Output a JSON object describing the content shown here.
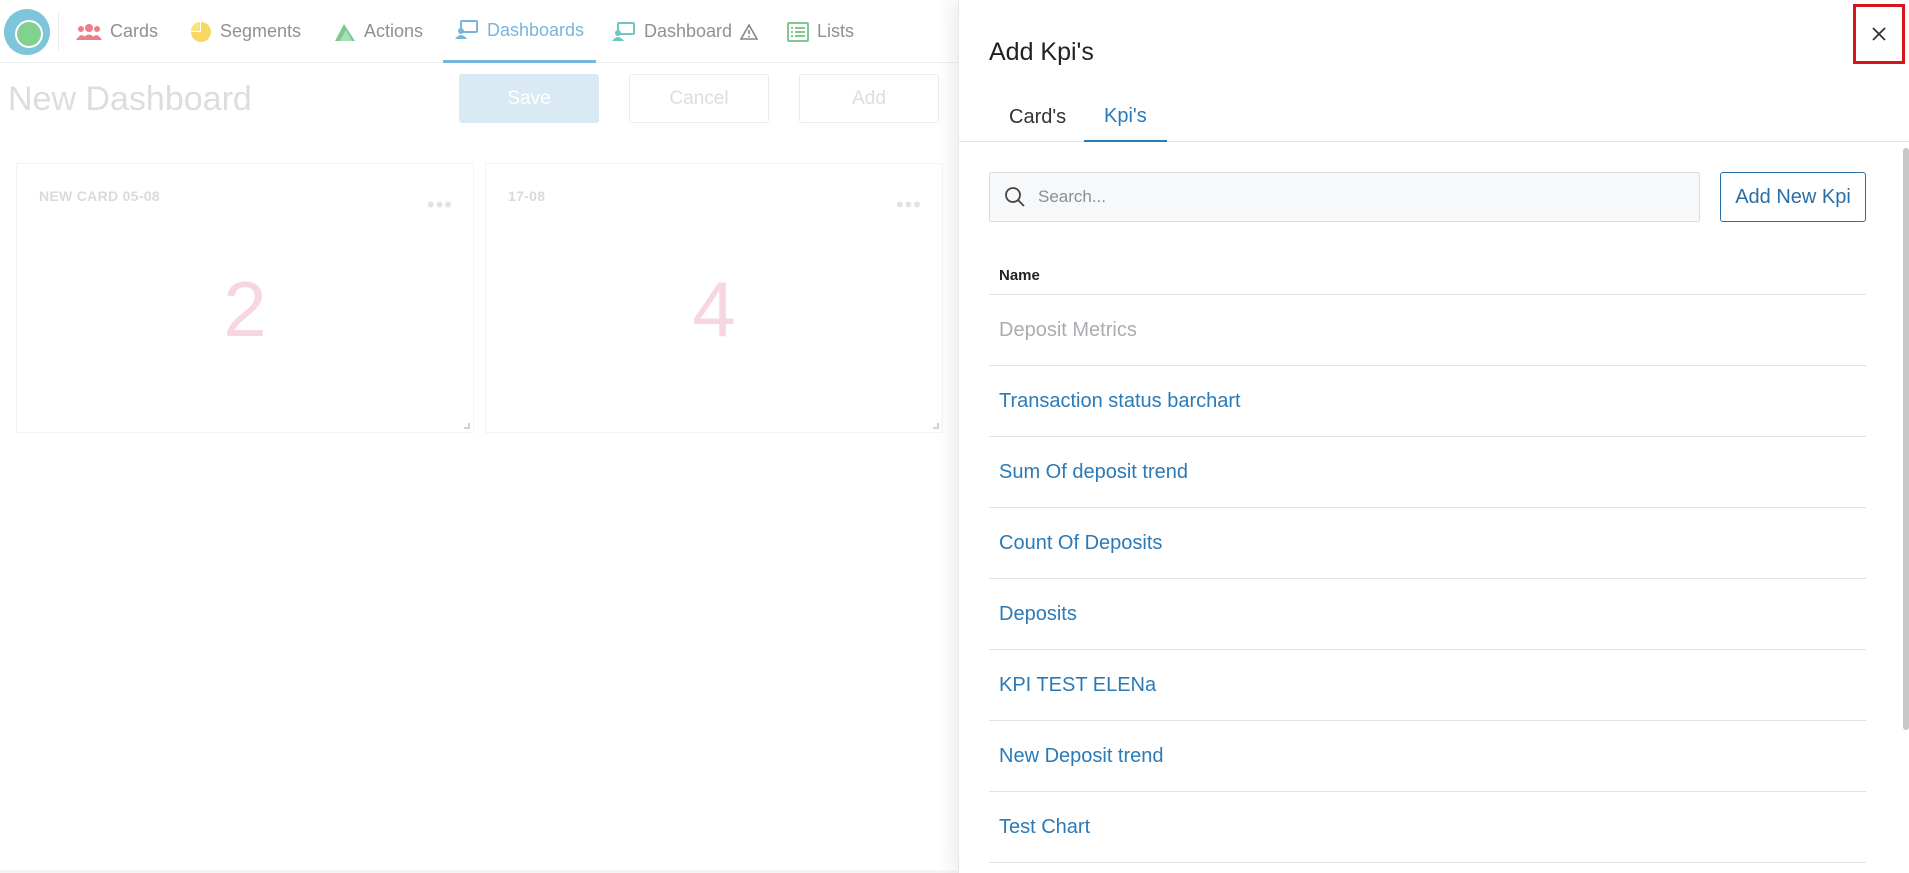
{
  "nav": {
    "items": [
      {
        "label": "Cards",
        "icon": "users-icon",
        "active": false
      },
      {
        "label": "Segments",
        "icon": "pie-chart-icon",
        "active": false
      },
      {
        "label": "Actions",
        "icon": "actions-icon",
        "active": false
      },
      {
        "label": "Dashboards",
        "icon": "dashboard-icon",
        "active": true
      },
      {
        "label": "Dashboard",
        "icon": "dashboard-warning-icon",
        "active": false
      },
      {
        "label": "Lists",
        "icon": "list-icon",
        "active": false
      }
    ]
  },
  "page": {
    "title": "New Dashboard",
    "buttons": {
      "save": "Save",
      "cancel": "Cancel",
      "add": "Add"
    }
  },
  "cards": [
    {
      "title": "NEW CARD 05-08",
      "value": "2"
    },
    {
      "title": "17-08",
      "value": "4"
    }
  ],
  "drawer": {
    "title": "Add Kpi's",
    "tabs": [
      {
        "label": "Card's",
        "active": false
      },
      {
        "label": "Kpi's",
        "active": true
      }
    ],
    "search": {
      "placeholder": "Search..."
    },
    "add_button": "Add New Kpi",
    "table": {
      "header": "Name",
      "rows": [
        {
          "name": "Deposit Metrics",
          "disabled": true
        },
        {
          "name": "Transaction status barchart",
          "disabled": false
        },
        {
          "name": "Sum Of deposit trend",
          "disabled": false
        },
        {
          "name": "Count Of Deposits",
          "disabled": false
        },
        {
          "name": "Deposits",
          "disabled": false
        },
        {
          "name": "KPI TEST ELENa",
          "disabled": false
        },
        {
          "name": "New Deposit trend",
          "disabled": false
        },
        {
          "name": "Test Chart",
          "disabled": false
        }
      ]
    }
  },
  "colors": {
    "accent": "#2a7ab8",
    "close_highlight": "#d6151f",
    "card_value": "#f4c1cf"
  }
}
